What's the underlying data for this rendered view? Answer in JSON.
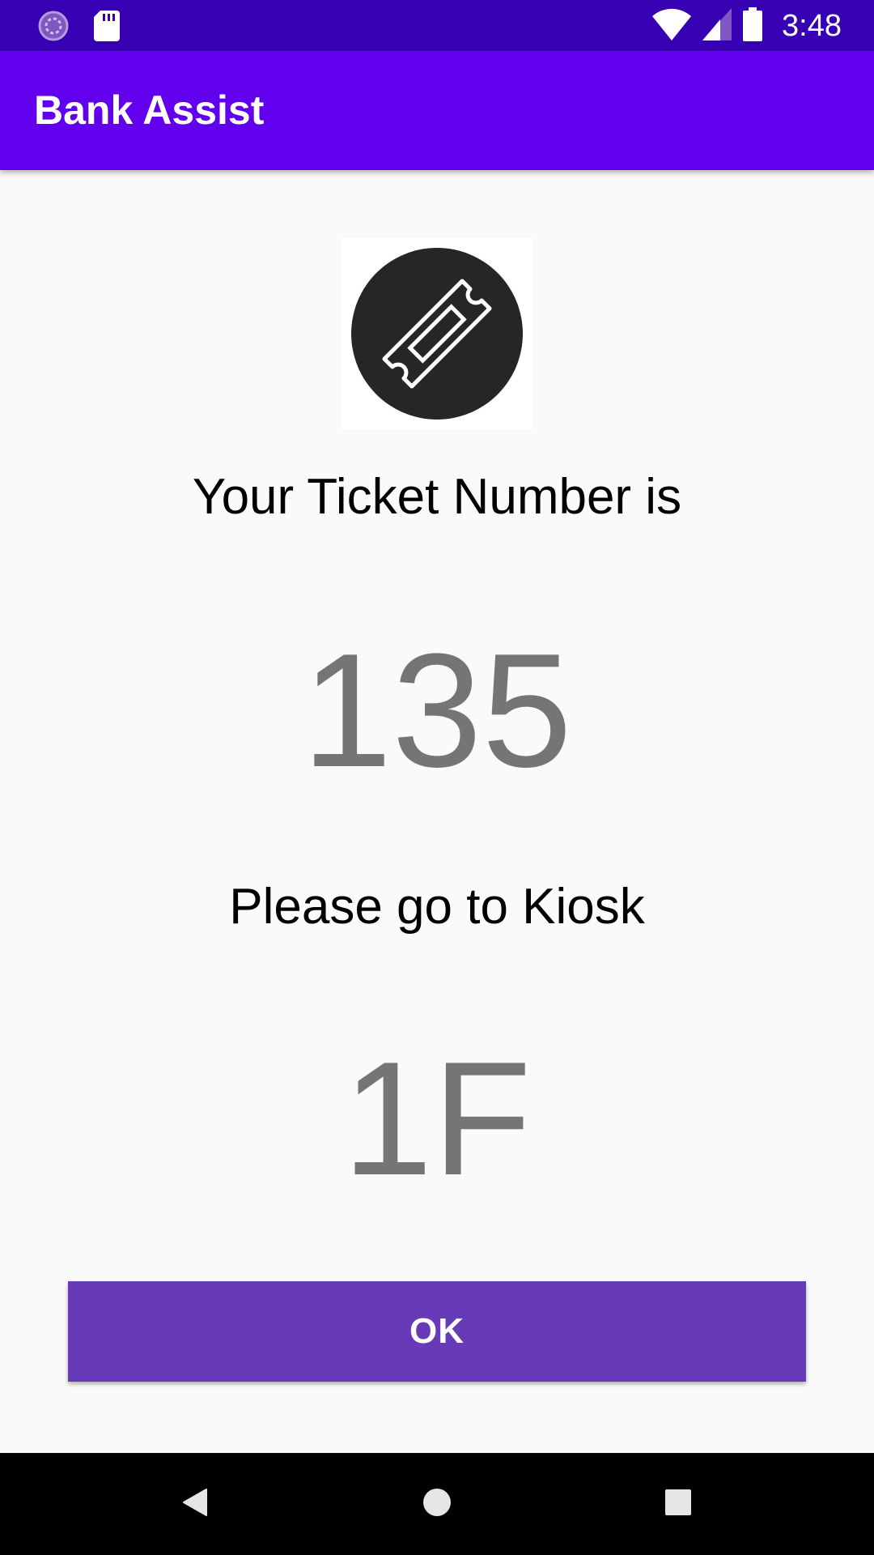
{
  "status_bar": {
    "time": "3:48",
    "icons": [
      "sync-icon",
      "sd-card-icon",
      "wifi-icon",
      "cellular-signal-icon",
      "battery-icon"
    ]
  },
  "app_bar": {
    "title": "Bank Assist",
    "color": "#6200ee",
    "status_color": "#3700b3"
  },
  "main": {
    "ticket_icon": "ticket-icon",
    "ticket_label": "Your Ticket Number is",
    "ticket_number": "135",
    "kiosk_label": "Please go to Kiosk",
    "kiosk_value": "1F",
    "ok_label": "OK",
    "ok_color": "#673ab7"
  },
  "nav_bar": {
    "icons": [
      "back-icon",
      "home-icon",
      "recents-icon"
    ]
  }
}
